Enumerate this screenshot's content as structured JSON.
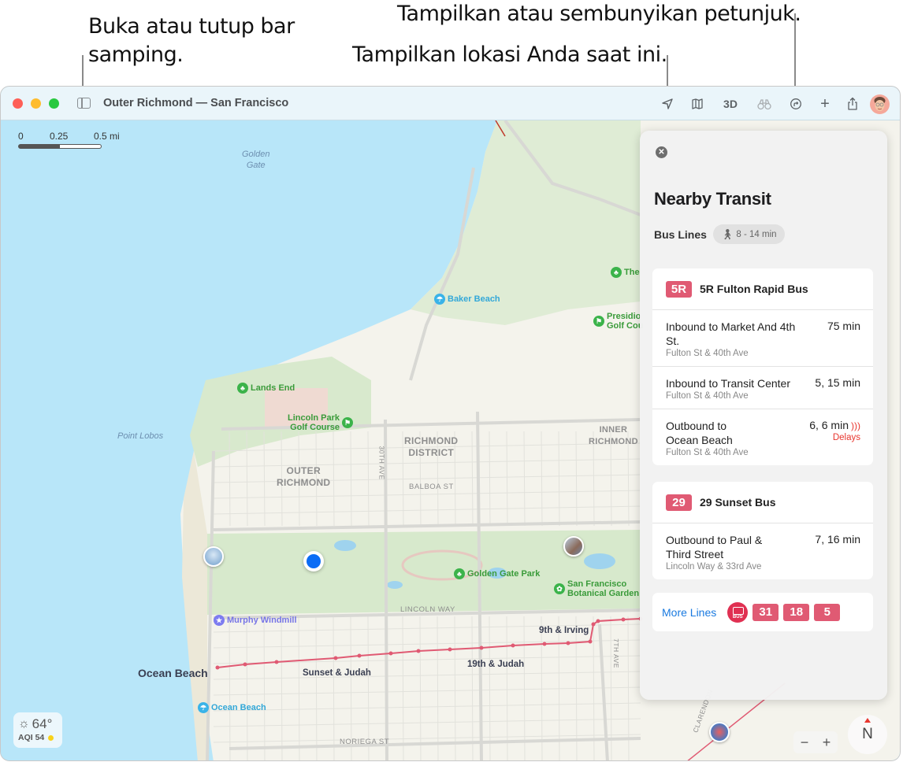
{
  "callouts": {
    "sidebar": "Buka atau tutup bar samping.",
    "sidebar_line1": "Buka atau tutup bar",
    "sidebar_line2": "samping.",
    "location": "Tampilkan lokasi Anda saat ini.",
    "directions": "Tampilkan atau sembunyikan petunjuk."
  },
  "window": {
    "title": "Outer Richmond — San Francisco",
    "toolbar": {
      "location_icon": "location-arrow-icon",
      "map_icon": "map-icon",
      "three_d_label": "3D",
      "lookaround_icon": "binoculars-icon",
      "directions_icon": "directions-icon",
      "add_icon": "plus-icon",
      "share_icon": "share-icon",
      "avatar": "user-avatar"
    }
  },
  "map": {
    "scale": {
      "labels": [
        "0",
        "0.25",
        "0.5 mi"
      ]
    },
    "water_labels": {
      "golden_gate_1": "Golden",
      "golden_gate_2": "Gate",
      "point_lobos": "Point Lobos"
    },
    "districts": {
      "richmond_1": "RICHMOND",
      "richmond_2": "DISTRICT",
      "outer_1": "OUTER",
      "outer_2": "RICHMOND",
      "inner_1": "INNER",
      "inner_2": "RICHMOND"
    },
    "streets": {
      "balboa": "BALBOA ST",
      "lincoln": "LINCOLN WAY",
      "noriega": "NORIEGA ST",
      "thirtieth": "30TH AVE",
      "seventh": "7TH AVE",
      "clarendon": "CLARENDON"
    },
    "places": {
      "baker_beach": "Baker Beach",
      "lands_end": "Lands End",
      "lincoln_park_1": "Lincoln Park",
      "lincoln_park_2": "Golf Course",
      "presidio_1": "Presidio",
      "presidio_2": "Golf Cou",
      "the": "The",
      "golden_gate_park": "Golden Gate Park",
      "botanical_1": "San Francisco",
      "botanical_2": "Botanical Garden",
      "murphy_windmill": "Murphy Windmill",
      "ocean_beach_big": "Ocean Beach",
      "ocean_beach": "Ocean Beach"
    },
    "stops": {
      "sunset_judah": "Sunset & Judah",
      "nineteenth_judah": "19th & Judah",
      "ninth_irving": "9th & Irving"
    },
    "weather": {
      "temp": "64°",
      "aqi": "AQI 54",
      "icon": "sun-icon"
    },
    "zoom": {
      "out": "−",
      "in": "+"
    },
    "compass": "N"
  },
  "panel": {
    "title": "Nearby Transit",
    "subtitle": "Bus Lines",
    "walk_time": "8 - 14 min",
    "routes": [
      {
        "badge": "5R",
        "name": "5R Fulton Rapid Bus",
        "trips": [
          {
            "dest": "Inbound to Market And 4th St.",
            "stop": "Fulton St & 40th Ave",
            "time": "75 min"
          },
          {
            "dest": "Inbound to Transit Center",
            "stop": "Fulton St & 40th Ave",
            "time": "5, 15 min"
          },
          {
            "dest": "Outbound to Ocean Beach",
            "stop": "Fulton St & 40th Ave",
            "time": "6, 6 min",
            "status": "Delays"
          }
        ]
      },
      {
        "badge": "29",
        "name": "29 Sunset Bus",
        "trips": [
          {
            "dest": "Outbound to Paul & Third Street",
            "stop": "Lincoln Way & 33rd Ave",
            "time": "7, 16 min"
          }
        ]
      }
    ],
    "more_lines": {
      "label": "More Lines",
      "bus_icon_text": "BUS",
      "badges": [
        "31",
        "18",
        "5"
      ]
    },
    "colors": {
      "route": "#e05a73",
      "delay": "#e8362e",
      "link": "#1a7ae0"
    }
  }
}
